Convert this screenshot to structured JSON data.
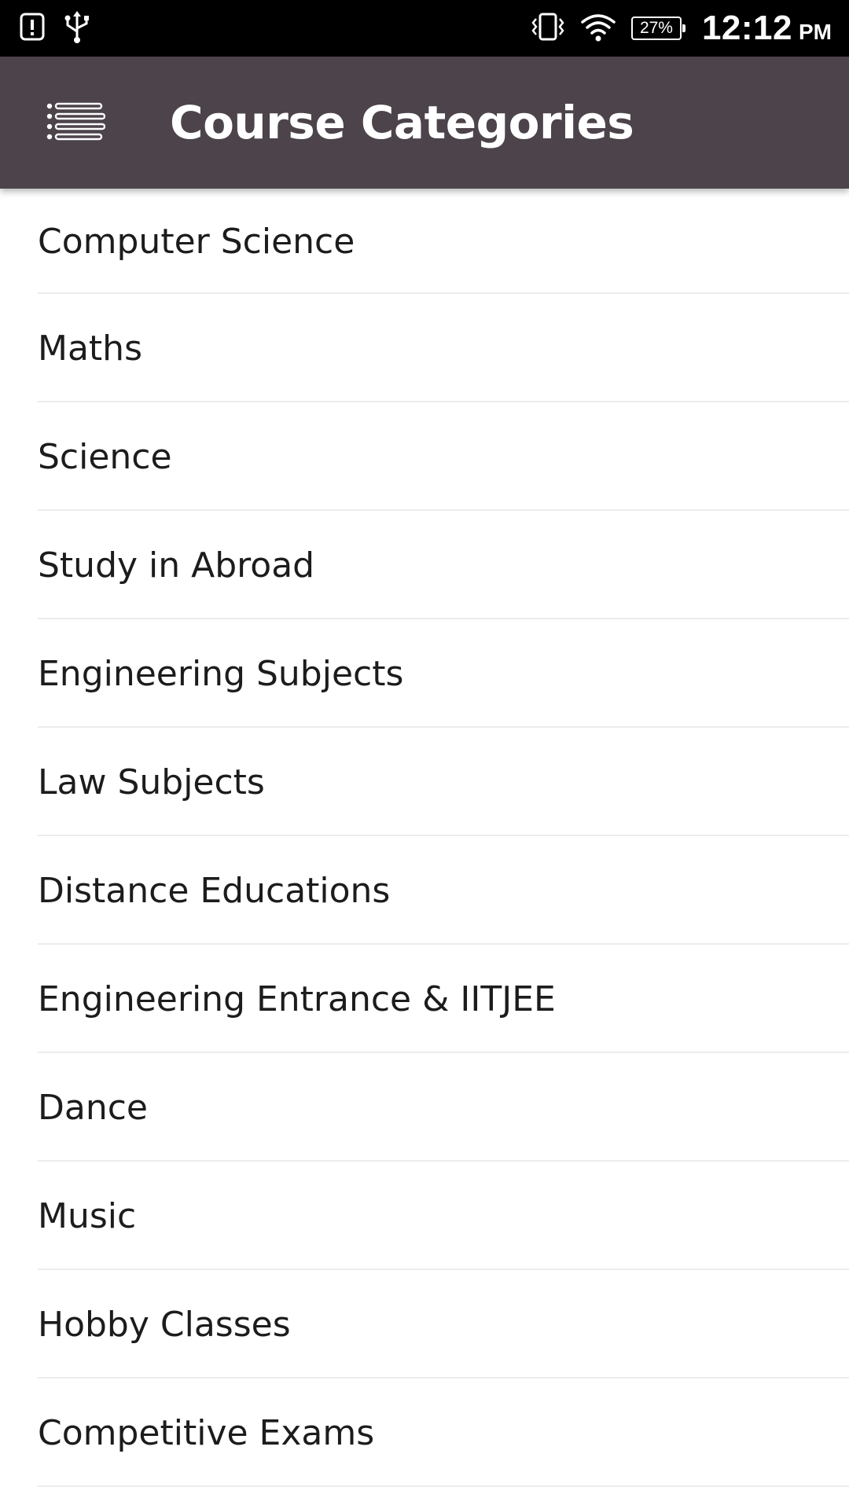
{
  "status_bar": {
    "battery_percent": "27%",
    "time": "12:12",
    "ampm": "PM",
    "icons": [
      "alert-icon",
      "usb-icon",
      "vibrate-icon",
      "wifi-icon",
      "battery-icon"
    ]
  },
  "app_bar": {
    "title": "Course Categories",
    "menu_icon": "menu-list-icon",
    "background_color": "#4c434b"
  },
  "categories": [
    {
      "label": "Computer Science"
    },
    {
      "label": "Maths"
    },
    {
      "label": "Science"
    },
    {
      "label": "Study in Abroad"
    },
    {
      "label": "Engineering Subjects"
    },
    {
      "label": "Law Subjects"
    },
    {
      "label": "Distance Educations"
    },
    {
      "label": "Engineering Entrance & IITJEE"
    },
    {
      "label": "Dance"
    },
    {
      "label": "Music"
    },
    {
      "label": "Hobby Classes"
    },
    {
      "label": "Competitive Exams"
    }
  ]
}
